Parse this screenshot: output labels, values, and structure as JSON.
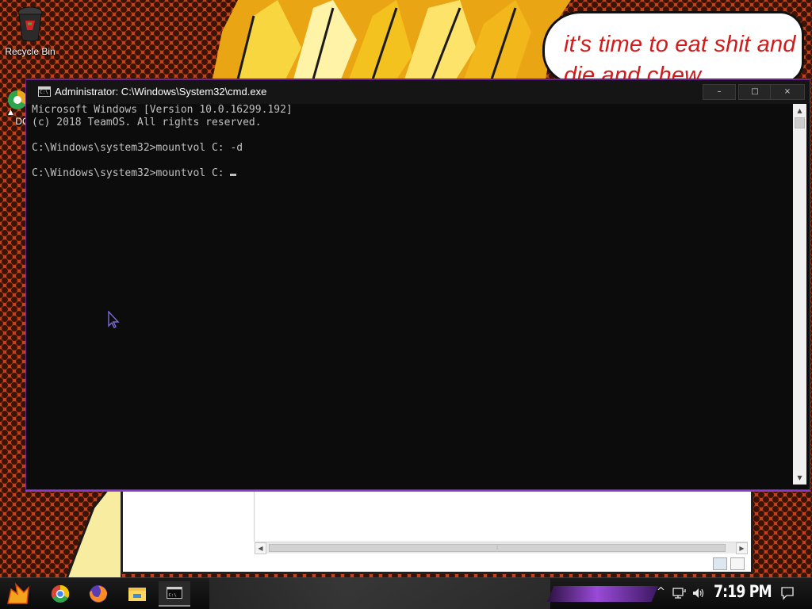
{
  "wallpaper": {
    "speech_text": "it's time to eat shit and die and chew"
  },
  "desktop": {
    "icons": [
      {
        "label": "Recycle Bin",
        "icon": "recycle-bin-icon"
      },
      {
        "label": "DC",
        "icon": "chrome-desktop-shortcut-icon"
      }
    ]
  },
  "cmd_window": {
    "title": "Administrator: C:\\Windows\\System32\\cmd.exe",
    "controls": {
      "minimize": "–",
      "maximize": "□",
      "close": "×"
    },
    "lines": [
      "Microsoft Windows [Version 10.0.16299.192]",
      "(c) 2018 TeamOS. All rights reserved.",
      "",
      "C:\\Windows\\system32>mountvol C: -d",
      "",
      "C:\\Windows\\system32>mountvol C: "
    ],
    "colors": {
      "background": "#0c0c0c",
      "text": "#c0c0c0",
      "frame_accent": "#8c3dd0"
    }
  },
  "taskbar": {
    "apps": [
      "start-icon",
      "chrome-icon",
      "firefox-icon",
      "file-explorer-icon",
      "cmd-icon"
    ],
    "tray": {
      "chevron": "^",
      "network_icon": "network-icon",
      "volume_icon": "volume-icon",
      "notify_icon": "notifications-icon"
    },
    "clock": "7:19 PM"
  }
}
